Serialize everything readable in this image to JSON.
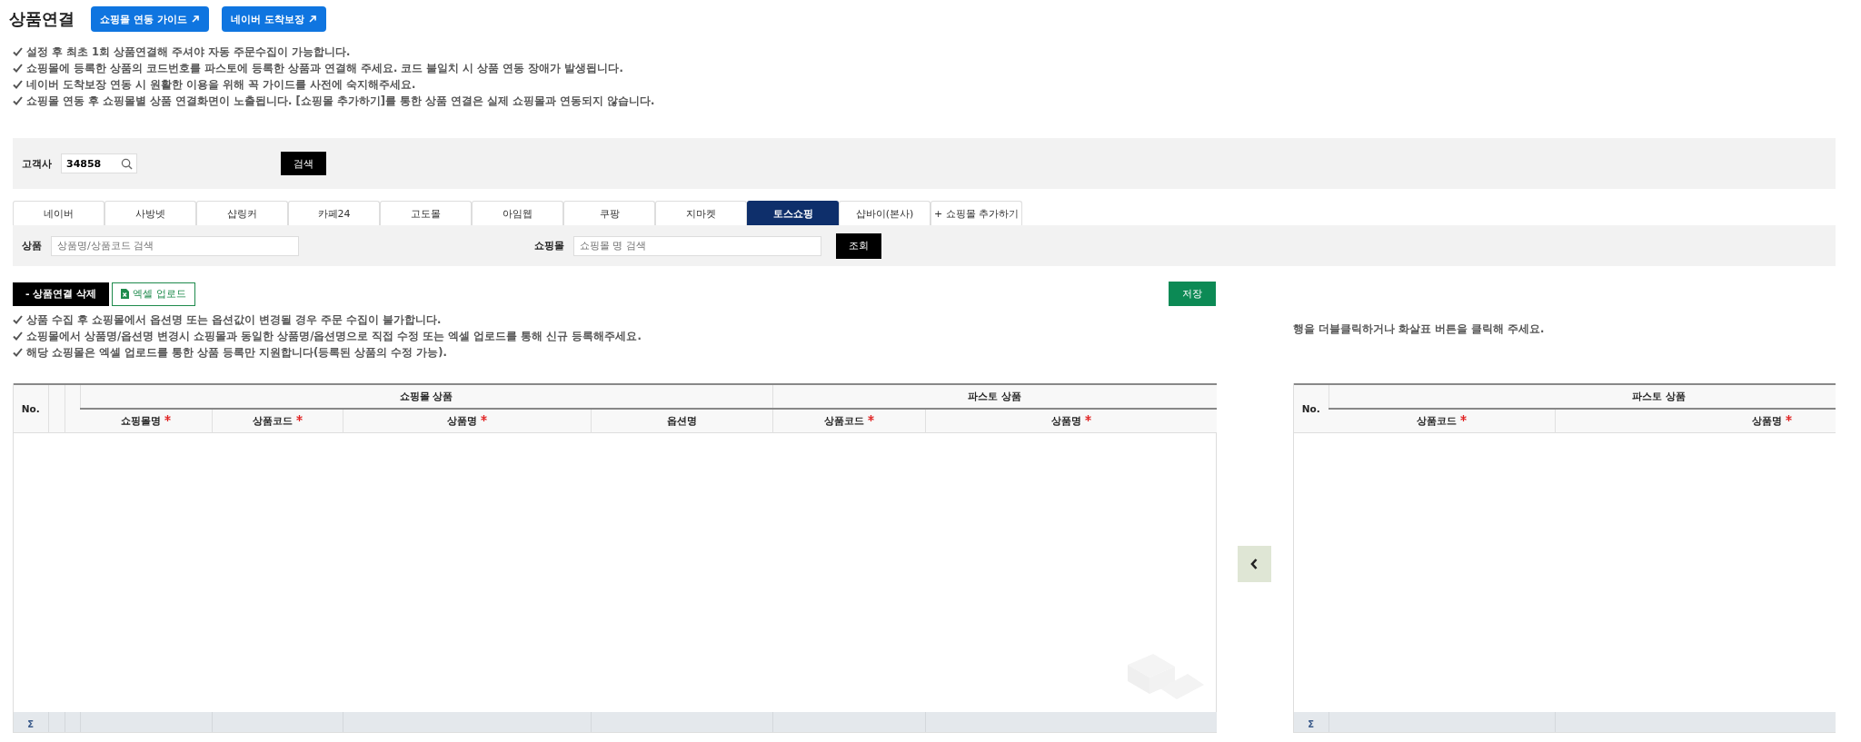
{
  "header": {
    "title": "상품연결",
    "links": [
      {
        "label": "쇼핑몰 연동 가이드"
      },
      {
        "label": "네이버 도착보장"
      }
    ]
  },
  "notes": [
    "설정 후 최초 **1**회 상품연결해 주셔야 자동 주문수집이 가능합니다.",
    "쇼핑몰에 등록한 상품의 코드번호를 파스토에 등록한 상품과 연결해 주세요. 코드 불일치 시 상품 연동 장애가 발생됩니다.",
    "네이버 도착보장 연동 시 원활한 이용을 위해 꼭 가이드를 사전에 숙지해주세요.",
    "쇼핑몰 연동 후 쇼핑몰별 상품 연결화면이 노출됩니다. [쇼핑몰 추가하기]를 통한 상품 연결은 실제 쇼핑몰과 연동되지 않습니다."
  ],
  "customer_search": {
    "label": "고객사",
    "value": "34858",
    "button": "검색"
  },
  "tabs": [
    {
      "label": "네이버",
      "selected": false
    },
    {
      "label": "사방넷",
      "selected": false
    },
    {
      "label": "샵링커",
      "selected": false
    },
    {
      "label": "카페24",
      "selected": false
    },
    {
      "label": "고도몰",
      "selected": false
    },
    {
      "label": "아임웹",
      "selected": false
    },
    {
      "label": "쿠팡",
      "selected": false
    },
    {
      "label": "지마켓",
      "selected": false
    },
    {
      "label": "토스쇼핑",
      "selected": true
    },
    {
      "label": "샵바이(본사)",
      "selected": false
    },
    {
      "label": "+ 쇼핑몰 추가하기",
      "selected": false
    }
  ],
  "filter": {
    "product_label": "상품",
    "product_placeholder": "상품명/상품코드 검색",
    "mall_label": "쇼핑몰",
    "mall_placeholder": "쇼핑몰 명 검색",
    "button": "조회"
  },
  "toolbar": {
    "delete_button": "- 상품연결 삭제",
    "excel_button": "엑셀 업로드",
    "save_button": "저장"
  },
  "table_notes": [
    "상품 수집 후 쇼핑몰에서 옵션명 또는 옵션값이 변경될 경우 주문 수집이 불가합니다.",
    "쇼핑몰에서 상품명/옵션명 변경시 쇼핑몰과 동일한 상품명/옵션명으로 직접 수정 또는 엑셀 업로드를 통해 신규 등록해주세요.",
    "해당 쇼핑몰은 엑셀 업로드를 통한 상품 등록만 지원합니다(등록된 상품의 수정 가능)."
  ],
  "right_hint": "행을 더블클릭하거나 화살표 버튼을 클릭해 주세요.",
  "left_table": {
    "no_label": "No.",
    "footer_label": "Σ",
    "groups": [
      {
        "label": "쇼핑몰 상품",
        "columns": [
          {
            "label": "쇼핑몰명",
            "required": true
          },
          {
            "label": "상품코드",
            "required": true
          },
          {
            "label": "상품명",
            "required": true
          },
          {
            "label": "옵션명",
            "required": false
          }
        ]
      },
      {
        "label": "파스토 상품",
        "columns": [
          {
            "label": "상품코드",
            "required": true
          },
          {
            "label": "상품명",
            "required": true
          }
        ]
      }
    ]
  },
  "right_table": {
    "no_label": "No.",
    "footer_label": "Σ",
    "groups": [
      {
        "label": "파스토 상품",
        "columns": [
          {
            "label": "상품코드",
            "required": true
          },
          {
            "label": "상품명",
            "required": true
          }
        ]
      }
    ]
  }
}
